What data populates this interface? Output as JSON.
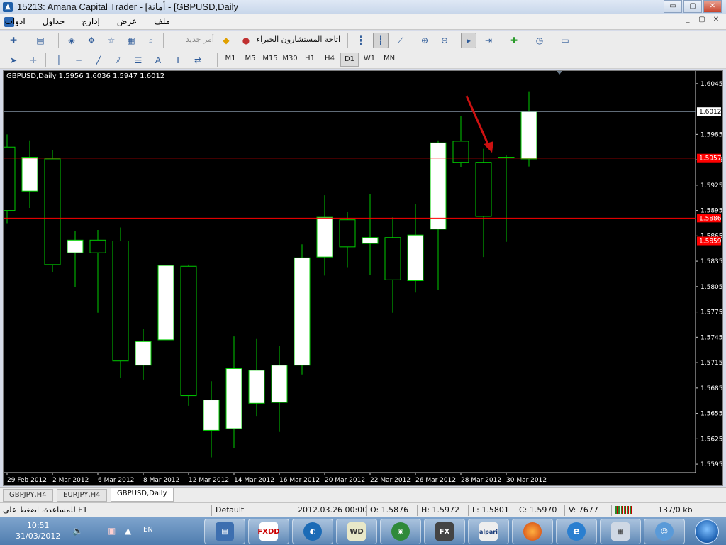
{
  "window": {
    "title": "15213: Amana Capital Trader - [أمانة - [GBPUSD,Daily",
    "buttons": [
      "▭",
      "▢",
      "✕"
    ]
  },
  "menu": {
    "items": [
      "ملف",
      "عرض",
      "إدارج",
      "جداول",
      "ادوات"
    ],
    "mdi_buttons": [
      "_",
      "▢",
      "✕"
    ]
  },
  "toolbar1": {
    "new_order_label": "أمر جديد",
    "experts_label": "اتاحة المستشارون الخبراء"
  },
  "toolbar2": {
    "timeframes": [
      "M1",
      "M5",
      "M15",
      "M30",
      "H1",
      "H4",
      "D1",
      "W1",
      "MN"
    ],
    "active_timeframe": "D1",
    "text_tool_label": "A"
  },
  "chart": {
    "header": "GBPUSD,Daily  1.5956 1.6036 1.5947 1.6012",
    "colors": {
      "background": "#000000",
      "bull_body": "#ffffff",
      "wick": "#00cc00",
      "hline": "#ff0000",
      "bid_line": "#8090a0",
      "axis_text": "#ffffff",
      "arrow": "#cc1111"
    }
  },
  "chart_data": {
    "type": "candlestick",
    "symbol": "GBPUSD",
    "timeframe": "Daily",
    "ylim": [
      1.5585,
      1.606
    ],
    "y_ticks": [
      "1.6045",
      "1.5985",
      "1.5955",
      "1.5925",
      "1.5895",
      "1.5865",
      "1.5835",
      "1.5805",
      "1.5775",
      "1.5745",
      "1.5715",
      "1.5685",
      "1.5655",
      "1.5625",
      "1.5595"
    ],
    "x_labels": [
      "29 Feb 2012",
      "2 Mar 2012",
      "6 Mar 2012",
      "8 Mar 2012",
      "12 Mar 2012",
      "14 Mar 2012",
      "16 Mar 2012",
      "20 Mar 2012",
      "22 Mar 2012",
      "26 Mar 2012",
      "28 Mar 2012",
      "30 Mar 2012"
    ],
    "candles": [
      {
        "o": 1.597,
        "h": 1.5985,
        "l": 1.588,
        "c": 1.5895
      },
      {
        "o": 1.5918,
        "h": 1.5978,
        "l": 1.5898,
        "c": 1.5958
      },
      {
        "o": 1.5956,
        "h": 1.5966,
        "l": 1.5822,
        "c": 1.5831
      },
      {
        "o": 1.5845,
        "h": 1.5871,
        "l": 1.5804,
        "c": 1.586
      },
      {
        "o": 1.586,
        "h": 1.5872,
        "l": 1.5774,
        "c": 1.5845
      },
      {
        "o": 1.5859,
        "h": 1.5875,
        "l": 1.5697,
        "c": 1.5717
      },
      {
        "o": 1.5712,
        "h": 1.5755,
        "l": 1.5695,
        "c": 1.574
      },
      {
        "o": 1.5742,
        "h": 1.583,
        "l": 1.5742,
        "c": 1.583
      },
      {
        "o": 1.5829,
        "h": 1.5831,
        "l": 1.5664,
        "c": 1.5676
      },
      {
        "o": 1.5635,
        "h": 1.5693,
        "l": 1.5603,
        "c": 1.5671
      },
      {
        "o": 1.5637,
        "h": 1.5746,
        "l": 1.5614,
        "c": 1.5708
      },
      {
        "o": 1.5667,
        "h": 1.5743,
        "l": 1.5652,
        "c": 1.5706
      },
      {
        "o": 1.5668,
        "h": 1.5735,
        "l": 1.5633,
        "c": 1.5712
      },
      {
        "o": 1.5712,
        "h": 1.5855,
        "l": 1.5701,
        "c": 1.5839
      },
      {
        "o": 1.584,
        "h": 1.5913,
        "l": 1.5818,
        "c": 1.5887
      },
      {
        "o": 1.5884,
        "h": 1.5893,
        "l": 1.5828,
        "c": 1.5852
      },
      {
        "o": 1.5856,
        "h": 1.5914,
        "l": 1.5819,
        "c": 1.5863
      },
      {
        "o": 1.5863,
        "h": 1.5887,
        "l": 1.5774,
        "c": 1.5813
      },
      {
        "o": 1.5812,
        "h": 1.5903,
        "l": 1.5798,
        "c": 1.5866
      },
      {
        "o": 1.5873,
        "h": 1.5978,
        "l": 1.5801,
        "c": 1.5975
      },
      {
        "o": 1.5977,
        "h": 1.6007,
        "l": 1.5946,
        "c": 1.5952
      },
      {
        "o": 1.5952,
        "h": 1.5968,
        "l": 1.584,
        "c": 1.5888
      },
      {
        "o": 1.5958,
        "h": 1.596,
        "l": 1.5858,
        "c": 1.5958
      },
      {
        "o": 1.5956,
        "h": 1.6036,
        "l": 1.5947,
        "c": 1.6012
      }
    ],
    "horizontal_lines": [
      {
        "value": 1.5957,
        "label": "1.5957",
        "color": "#ff0000"
      },
      {
        "value": 1.5886,
        "label": "1.5886",
        "color": "#ff0000"
      },
      {
        "value": 1.5859,
        "label": "1.5859",
        "color": "#ff0000"
      }
    ],
    "bid_line": {
      "value": 1.6012,
      "label": "1.6012"
    },
    "annotations": [
      {
        "type": "arrow",
        "color": "#cc1111",
        "pointing_to_candle_index": 22
      }
    ]
  },
  "tabs": {
    "items": [
      "GBPJPY,H4",
      "EURJPY,H4",
      "GBPUSD,Daily"
    ],
    "active": "GBPUSD,Daily"
  },
  "status": {
    "help": "للمساعدة، اضغط على F1",
    "profile": "Default",
    "datetime": "2012.03.26 00:00",
    "open": "O: 1.5876",
    "high": "H: 1.5972",
    "low": "L: 1.5801",
    "close": "C: 1.5970",
    "volume": "V: 7677",
    "traffic": "137/0 kb"
  },
  "taskbar": {
    "time": "10:51",
    "date": "31/03/2012",
    "lang": "EN",
    "apps": [
      "FXDD",
      "WD",
      "FX",
      "alpari"
    ]
  }
}
